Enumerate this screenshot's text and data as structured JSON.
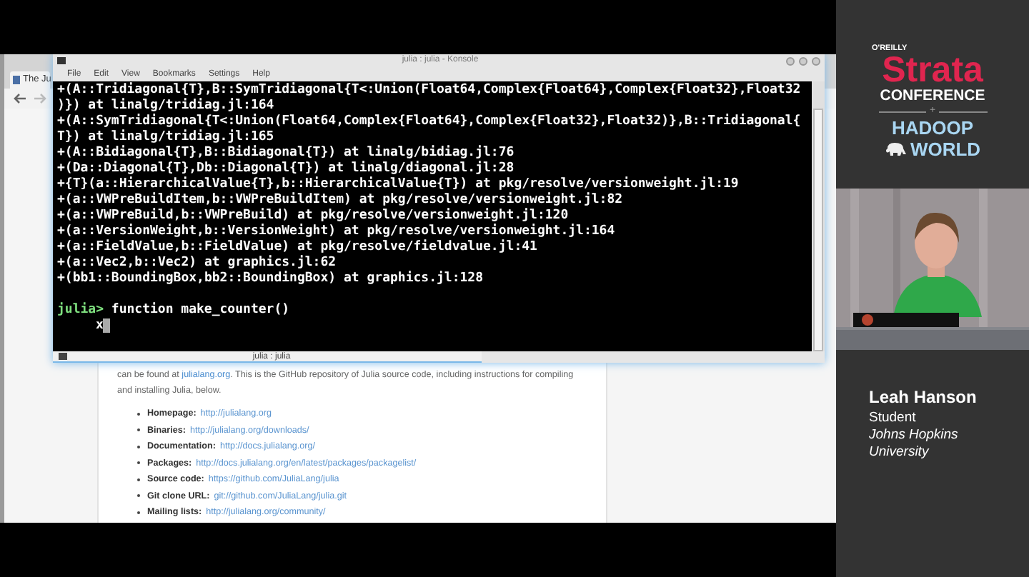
{
  "browser": {
    "tab": "The Ju",
    "page": {
      "intro_before": "can be found at",
      "intro_link": "julialang.org",
      "intro_after": ". This is the GitHub repository of Julia source code, including instructions for compiling and installing Julia, below.",
      "links": [
        {
          "label": "Homepage:",
          "url": "http://julialang.org"
        },
        {
          "label": "Binaries:",
          "url": "http://julialang.org/downloads/"
        },
        {
          "label": "Documentation:",
          "url": "http://docs.julialang.org/"
        },
        {
          "label": "Packages:",
          "url": "http://docs.julialang.org/en/latest/packages/packagelist/"
        },
        {
          "label": "Source code:",
          "url": "https://github.com/JuliaLang/julia"
        },
        {
          "label": "Git clone URL:",
          "url": "git://github.com/JuliaLang/julia.git"
        },
        {
          "label": "Mailing lists:",
          "url": "http://julialang.org/community/"
        }
      ]
    }
  },
  "terminal": {
    "title": "julia : julia - Konsole",
    "menu": [
      "File",
      "Edit",
      "View",
      "Bookmarks",
      "Settings",
      "Help"
    ],
    "output": [
      "+(A::Tridiagonal{T},B::SymTridiagonal{T<:Union(Float64,Complex{Float64},Complex{Float32},Float32",
      ")}) at linalg/tridiag.jl:164",
      "+(A::SymTridiagonal{T<:Union(Float64,Complex{Float64},Complex{Float32},Float32)},B::Tridiagonal{",
      "T}) at linalg/tridiag.jl:165",
      "+(A::Bidiagonal{T},B::Bidiagonal{T}) at linalg/bidiag.jl:76",
      "+(Da::Diagonal{T},Db::Diagonal{T}) at linalg/diagonal.jl:28",
      "+{T}(a::HierarchicalValue{T},b::HierarchicalValue{T}) at pkg/resolve/versionweight.jl:19",
      "+(a::VWPreBuildItem,b::VWPreBuildItem) at pkg/resolve/versionweight.jl:82",
      "+(a::VWPreBuild,b::VWPreBuild) at pkg/resolve/versionweight.jl:120",
      "+(a::VersionWeight,b::VersionWeight) at pkg/resolve/versionweight.jl:164",
      "+(a::FieldValue,b::FieldValue) at pkg/resolve/fieldvalue.jl:41",
      "+(a::Vec2,b::Vec2) at graphics.jl:62",
      "+(bb1::BoundingBox,bb2::BoundingBox) at graphics.jl:128"
    ],
    "prompt": "julia>",
    "command": "function make_counter()",
    "continuation": "x",
    "tab": "julia : julia"
  },
  "sidebar": {
    "publisher": "O'REILLY",
    "event": "Strata",
    "event_sub": "CONFERENCE",
    "joiner": "+",
    "partner_top": "HADOOP",
    "partner_bottom": "WORLD",
    "speaker": {
      "kind": "picture",
      "name": "Leah Hanson",
      "role": "Student",
      "affiliation": "Johns Hopkins University"
    }
  }
}
